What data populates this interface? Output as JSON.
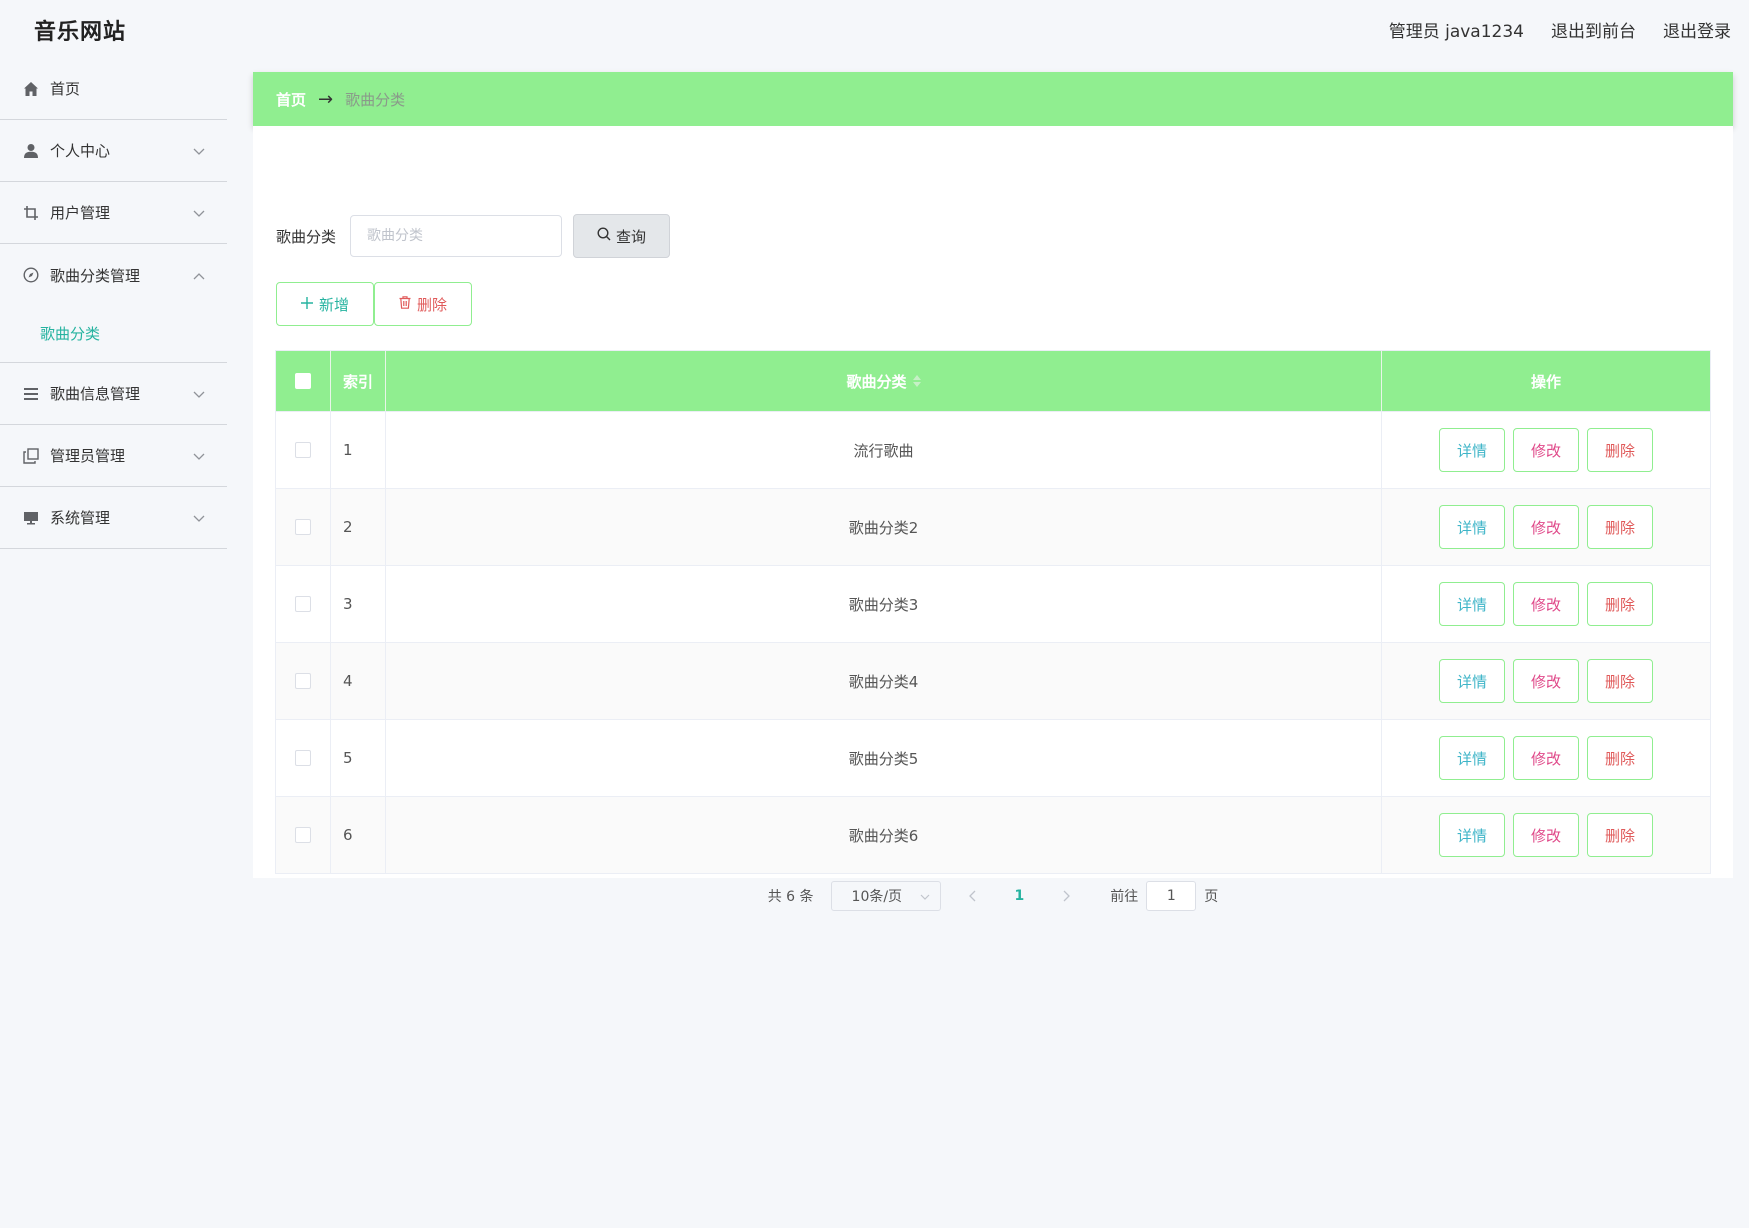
{
  "header": {
    "app_title": "音乐网站",
    "admin_label": "管理员 java1234",
    "front_link": "退出到前台",
    "logout_link": "退出登录"
  },
  "sidebar": {
    "items": [
      {
        "label": "首页",
        "icon": "home-icon"
      },
      {
        "label": "个人中心",
        "icon": "user-icon"
      },
      {
        "label": "用户管理",
        "icon": "crop-icon"
      },
      {
        "label": "歌曲分类管理",
        "icon": "compass-icon",
        "expanded": true,
        "children": [
          {
            "label": "歌曲分类"
          }
        ]
      },
      {
        "label": "歌曲信息管理",
        "icon": "list-icon"
      },
      {
        "label": "管理员管理",
        "icon": "copy-icon"
      },
      {
        "label": "系统管理",
        "icon": "monitor-icon"
      }
    ]
  },
  "breadcrumb": {
    "home": "首页",
    "separator": "→",
    "current": "歌曲分类"
  },
  "search": {
    "label": "歌曲分类",
    "placeholder": "歌曲分类",
    "value": "",
    "button": "查询"
  },
  "actions": {
    "add": "新增",
    "delete": "删除"
  },
  "table": {
    "columns": [
      "索引",
      "歌曲分类",
      "操作"
    ],
    "rows": [
      {
        "index": "1",
        "name": "流行歌曲"
      },
      {
        "index": "2",
        "name": "歌曲分类2"
      },
      {
        "index": "3",
        "name": "歌曲分类3"
      },
      {
        "index": "4",
        "name": "歌曲分类4"
      },
      {
        "index": "5",
        "name": "歌曲分类5"
      },
      {
        "index": "6",
        "name": "歌曲分类6"
      }
    ],
    "row_actions": {
      "detail": "详情",
      "edit": "修改",
      "remove": "删除"
    }
  },
  "pagination": {
    "total": "共 6 条",
    "page_size": "10条/页",
    "current_page": "1",
    "goto_label": "前往",
    "goto_value": "1",
    "page_suffix": "页"
  },
  "colors": {
    "accent_green": "#90ee90",
    "teal": "#26b3a0",
    "detail_blue": "#3fb5c8",
    "edit_pink": "#e04a8a",
    "danger_red": "#e05a5a"
  }
}
